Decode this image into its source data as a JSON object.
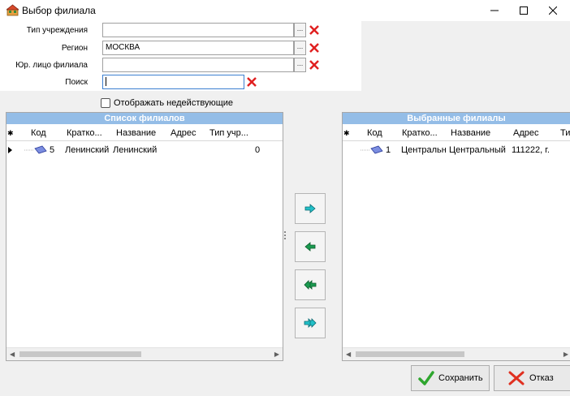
{
  "window": {
    "title": "Выбор филиала"
  },
  "filters": {
    "type_label": "Тип учреждения",
    "type_value": "",
    "region_label": "Регион",
    "region_value": "МОСКВА",
    "legal_label": "Юр. лицо филиала",
    "legal_value": "",
    "search_label": "Поиск",
    "search_value": "",
    "ellipsis": "...",
    "show_inactive_label": "Отображать недействующие",
    "show_inactive_checked": false
  },
  "branch_list": {
    "title": "Список филиалов",
    "columns": {
      "indicator": "✱",
      "code": "Код",
      "short": "Кратко...",
      "name": "Название",
      "address": "Адрес",
      "type": "Тип учр..."
    },
    "rows": [
      {
        "code": "5",
        "short": "Ленинский",
        "name": "Ленинский",
        "address": "",
        "type": "0"
      }
    ]
  },
  "selected_list": {
    "title": "Выбранные филиалы",
    "columns": {
      "indicator": "✱",
      "code": "Код",
      "short": "Кратко...",
      "name": "Название",
      "address": "Адрес",
      "type": "Ти"
    },
    "rows": [
      {
        "code": "1",
        "short": "Центральн",
        "name": "Центральный",
        "address": "111222, г.",
        "type": ""
      }
    ]
  },
  "actions": {
    "save_label": "Сохранить",
    "cancel_label": "Отказ"
  },
  "colors": {
    "panel_header": "#94bde7",
    "clear_red": "#e02020",
    "arrow_green": "#1a9a50",
    "arrow_cyan": "#22c0c8"
  }
}
